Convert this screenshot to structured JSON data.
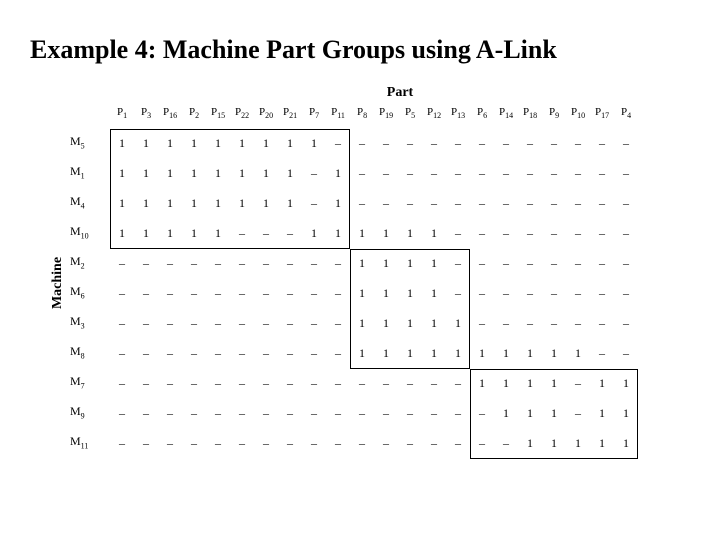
{
  "title": "Example 4: Machine Part Groups using A-Link",
  "axis": {
    "top": "Part",
    "left": "Machine"
  },
  "columns": [
    "P1",
    "P3",
    "P16",
    "P2",
    "P15",
    "P22",
    "P20",
    "P21",
    "P7",
    "P11",
    "P8",
    "P19",
    "P5",
    "P12",
    "P13",
    "P6",
    "P14",
    "P18",
    "P9",
    "P10",
    "P17",
    "P4"
  ],
  "rows": [
    "M5",
    "M1",
    "M4",
    "M10",
    "M2",
    "M6",
    "M3",
    "M8",
    "M7",
    "M9",
    "M11"
  ],
  "matrix": [
    [
      1,
      1,
      1,
      1,
      1,
      1,
      1,
      1,
      1,
      0,
      0,
      0,
      0,
      0,
      0,
      0,
      0,
      0,
      0,
      0,
      0,
      0
    ],
    [
      1,
      1,
      1,
      1,
      1,
      1,
      1,
      1,
      0,
      1,
      0,
      0,
      0,
      0,
      0,
      0,
      0,
      0,
      0,
      0,
      0,
      0
    ],
    [
      1,
      1,
      1,
      1,
      1,
      1,
      1,
      1,
      0,
      1,
      0,
      0,
      0,
      0,
      0,
      0,
      0,
      0,
      0,
      0,
      0,
      0
    ],
    [
      1,
      1,
      1,
      1,
      1,
      0,
      0,
      0,
      1,
      1,
      1,
      1,
      1,
      1,
      0,
      0,
      0,
      0,
      0,
      0,
      0,
      0
    ],
    [
      0,
      0,
      0,
      0,
      0,
      0,
      0,
      0,
      0,
      0,
      1,
      1,
      1,
      1,
      0,
      0,
      0,
      0,
      0,
      0,
      0,
      0
    ],
    [
      0,
      0,
      0,
      0,
      0,
      0,
      0,
      0,
      0,
      0,
      1,
      1,
      1,
      1,
      0,
      0,
      0,
      0,
      0,
      0,
      0,
      0
    ],
    [
      0,
      0,
      0,
      0,
      0,
      0,
      0,
      0,
      0,
      0,
      1,
      1,
      1,
      1,
      1,
      0,
      0,
      0,
      0,
      0,
      0,
      0
    ],
    [
      0,
      0,
      0,
      0,
      0,
      0,
      0,
      0,
      0,
      0,
      1,
      1,
      1,
      1,
      1,
      1,
      1,
      1,
      1,
      1,
      0,
      0
    ],
    [
      0,
      0,
      0,
      0,
      0,
      0,
      0,
      0,
      0,
      0,
      0,
      0,
      0,
      0,
      0,
      1,
      1,
      1,
      1,
      0,
      1,
      1
    ],
    [
      0,
      0,
      0,
      0,
      0,
      0,
      0,
      0,
      0,
      0,
      0,
      0,
      0,
      0,
      0,
      0,
      1,
      1,
      1,
      0,
      1,
      1
    ],
    [
      0,
      0,
      0,
      0,
      0,
      0,
      0,
      0,
      0,
      0,
      0,
      0,
      0,
      0,
      0,
      0,
      0,
      1,
      1,
      1,
      1,
      1
    ]
  ],
  "chart_data": {
    "type": "table",
    "title": "Machine-Part Incidence Matrix (A-Link Clustering)",
    "xlabel": "Part",
    "ylabel": "Machine",
    "categories": [
      "P1",
      "P3",
      "P16",
      "P2",
      "P15",
      "P22",
      "P20",
      "P21",
      "P7",
      "P11",
      "P8",
      "P19",
      "P5",
      "P12",
      "P13",
      "P6",
      "P14",
      "P18",
      "P9",
      "P10",
      "P17",
      "P4"
    ],
    "series": [
      {
        "name": "M5",
        "values": [
          1,
          1,
          1,
          1,
          1,
          1,
          1,
          1,
          1,
          0,
          0,
          0,
          0,
          0,
          0,
          0,
          0,
          0,
          0,
          0,
          0,
          0
        ]
      },
      {
        "name": "M1",
        "values": [
          1,
          1,
          1,
          1,
          1,
          1,
          1,
          1,
          0,
          1,
          0,
          0,
          0,
          0,
          0,
          0,
          0,
          0,
          0,
          0,
          0,
          0
        ]
      },
      {
        "name": "M4",
        "values": [
          1,
          1,
          1,
          1,
          1,
          1,
          1,
          1,
          0,
          1,
          0,
          0,
          0,
          0,
          0,
          0,
          0,
          0,
          0,
          0,
          0,
          0
        ]
      },
      {
        "name": "M10",
        "values": [
          1,
          1,
          1,
          1,
          1,
          0,
          0,
          0,
          1,
          1,
          1,
          1,
          1,
          1,
          0,
          0,
          0,
          0,
          0,
          0,
          0,
          0
        ]
      },
      {
        "name": "M2",
        "values": [
          0,
          0,
          0,
          0,
          0,
          0,
          0,
          0,
          0,
          0,
          1,
          1,
          1,
          1,
          0,
          0,
          0,
          0,
          0,
          0,
          0,
          0
        ]
      },
      {
        "name": "M6",
        "values": [
          0,
          0,
          0,
          0,
          0,
          0,
          0,
          0,
          0,
          0,
          1,
          1,
          1,
          1,
          0,
          0,
          0,
          0,
          0,
          0,
          0,
          0
        ]
      },
      {
        "name": "M3",
        "values": [
          0,
          0,
          0,
          0,
          0,
          0,
          0,
          0,
          0,
          0,
          1,
          1,
          1,
          1,
          1,
          0,
          0,
          0,
          0,
          0,
          0,
          0
        ]
      },
      {
        "name": "M8",
        "values": [
          0,
          0,
          0,
          0,
          0,
          0,
          0,
          0,
          0,
          0,
          1,
          1,
          1,
          1,
          1,
          1,
          1,
          1,
          1,
          1,
          0,
          0
        ]
      },
      {
        "name": "M7",
        "values": [
          0,
          0,
          0,
          0,
          0,
          0,
          0,
          0,
          0,
          0,
          0,
          0,
          0,
          0,
          0,
          1,
          1,
          1,
          1,
          0,
          1,
          1
        ]
      },
      {
        "name": "M9",
        "values": [
          0,
          0,
          0,
          0,
          0,
          0,
          0,
          0,
          0,
          0,
          0,
          0,
          0,
          0,
          0,
          0,
          1,
          1,
          1,
          0,
          1,
          1
        ]
      },
      {
        "name": "M11",
        "values": [
          0,
          0,
          0,
          0,
          0,
          0,
          0,
          0,
          0,
          0,
          0,
          0,
          0,
          0,
          0,
          0,
          0,
          1,
          1,
          1,
          1,
          1
        ]
      }
    ],
    "clusters": [
      {
        "rows": [
          "M5",
          "M1",
          "M4",
          "M10"
        ],
        "cols": [
          "P1",
          "P3",
          "P16",
          "P2",
          "P15",
          "P22",
          "P20",
          "P21",
          "P7",
          "P11"
        ]
      },
      {
        "rows": [
          "M2",
          "M6",
          "M3",
          "M8"
        ],
        "cols": [
          "P8",
          "P19",
          "P5",
          "P12",
          "P13"
        ]
      },
      {
        "rows": [
          "M7",
          "M9",
          "M11"
        ],
        "cols": [
          "P6",
          "P14",
          "P18",
          "P9",
          "P10",
          "P17",
          "P4"
        ]
      }
    ]
  }
}
